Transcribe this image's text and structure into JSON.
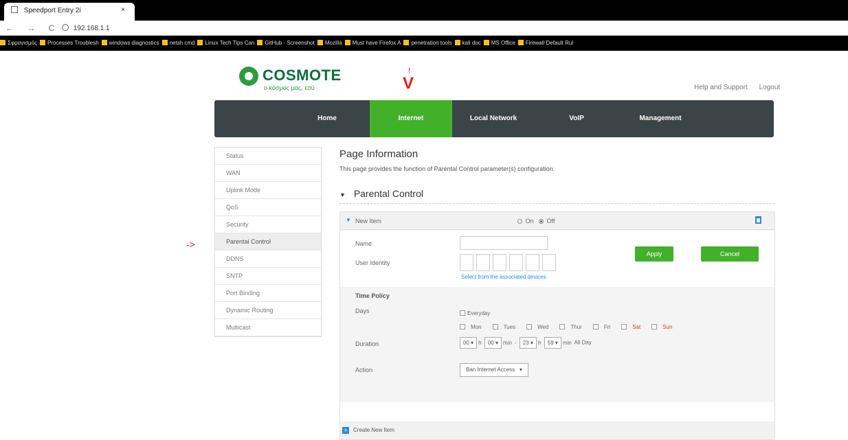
{
  "browser": {
    "tab_title": "Speedport Entry 2i",
    "tab_close": "×",
    "nav_glyphs": "← → C",
    "url": "192.168.1.1",
    "bookmarks": [
      "Σφραγισμός",
      "Processes Troublesh",
      "windows diagnostics",
      "netsh cmd",
      "Linux Tech Tips Can",
      "GitHub - Screenshot",
      "Mozilla",
      "Must have Firefox A",
      "penetration tools",
      "kali doc",
      "MS Office",
      "Firewall Default Rul"
    ]
  },
  "header": {
    "brand": "COSMOTE",
    "slogan": "ο κόσμος μας, εσύ",
    "help_link": "Help and Support",
    "logout_link": "Logout",
    "annotation_marker": "!",
    "annotation_v": "V"
  },
  "mainnav": {
    "items": [
      "Home",
      "Internet",
      "Local Network",
      "VoIP",
      "Management"
    ],
    "active": "Internet",
    "active_color": "#43b02a"
  },
  "sidebar": {
    "items": [
      "Status",
      "WAN",
      "Uplink Mode",
      "QoS",
      "Security",
      "Parental Control",
      "DDNS",
      "SNTP",
      "Port Binding",
      "Dynamic Routing",
      "Multicast"
    ],
    "active": "Parental Control",
    "annotation": "->"
  },
  "page": {
    "title": "Page Information",
    "description": "This page provides the function of Parental Control parameter(s) configuration.",
    "section_title": "Parental Control"
  },
  "form": {
    "item_title": "New Item",
    "on_label": "On",
    "off_label": "Off",
    "selected": "Off",
    "name_label": "Name",
    "name_value": "",
    "user_identity_label": "User Identity",
    "select_link": "Select from the associated devices",
    "time_policy_label": "Time Policy",
    "days_label": "Days",
    "everyday_label": "Everyday",
    "weekdays": [
      "Mon",
      "Tues",
      "Wed",
      "Thur",
      "Fri",
      "Sat",
      "Sun"
    ],
    "duration_label": "Duration",
    "start_hour": "00",
    "start_min": "00",
    "end_hour": "23",
    "end_min": "59",
    "h_unit": "h",
    "min_unit": "min",
    "range_sep": "-",
    "all_day": "All Day",
    "action_label": "Action",
    "action_value": "Ban Internet Access",
    "apply_label": "Apply",
    "cancel_label": "Cancel",
    "create_label": "Create New Item"
  }
}
